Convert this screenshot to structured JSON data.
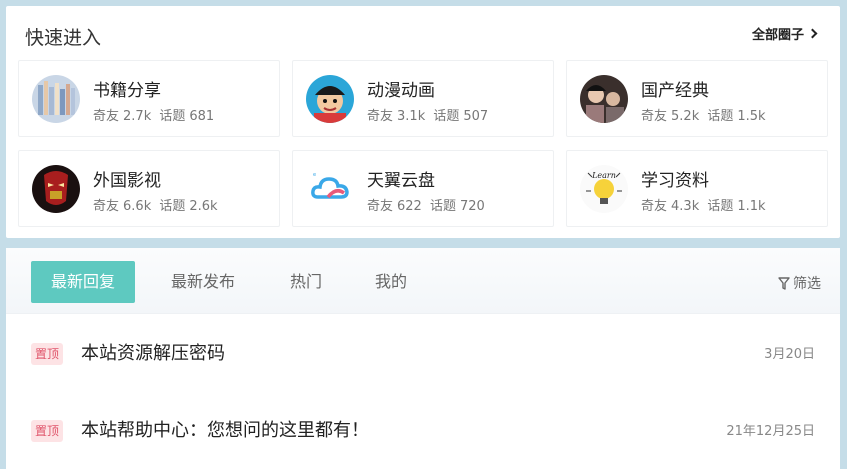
{
  "quick": {
    "title": "快速进入",
    "all_label": "全部圈子",
    "cards": [
      {
        "name": "书籍分享",
        "members_label": "奇友",
        "members": "2.7k",
        "topics_label": "话题",
        "topics": "681"
      },
      {
        "name": "动漫动画",
        "members_label": "奇友",
        "members": "3.1k",
        "topics_label": "话题",
        "topics": "507"
      },
      {
        "name": "国产经典",
        "members_label": "奇友",
        "members": "5.2k",
        "topics_label": "话题",
        "topics": "1.5k"
      },
      {
        "name": "外国影视",
        "members_label": "奇友",
        "members": "6.6k",
        "topics_label": "话题",
        "topics": "2.6k"
      },
      {
        "name": "天翼云盘",
        "members_label": "奇友",
        "members": "622",
        "topics_label": "话题",
        "topics": "720"
      },
      {
        "name": "学习资料",
        "members_label": "奇友",
        "members": "4.3k",
        "topics_label": "话题",
        "topics": "1.1k",
        "avatar_text": "Learn"
      }
    ]
  },
  "tabs": {
    "latest_reply": "最新回复",
    "latest_post": "最新发布",
    "hot": "热门",
    "mine": "我的",
    "filter": "筛选"
  },
  "posts": [
    {
      "badge": "置顶",
      "title": "本站资源解压密码",
      "date": "3月20日"
    },
    {
      "badge": "置顶",
      "title": "本站帮助中心：您想问的这里都有！",
      "date": "21年12月25日"
    }
  ],
  "colors": {
    "accent": "#5ec9c0",
    "badge_bg": "#fde3e5",
    "badge_text": "#e0546a",
    "background": "#c5dde8"
  }
}
